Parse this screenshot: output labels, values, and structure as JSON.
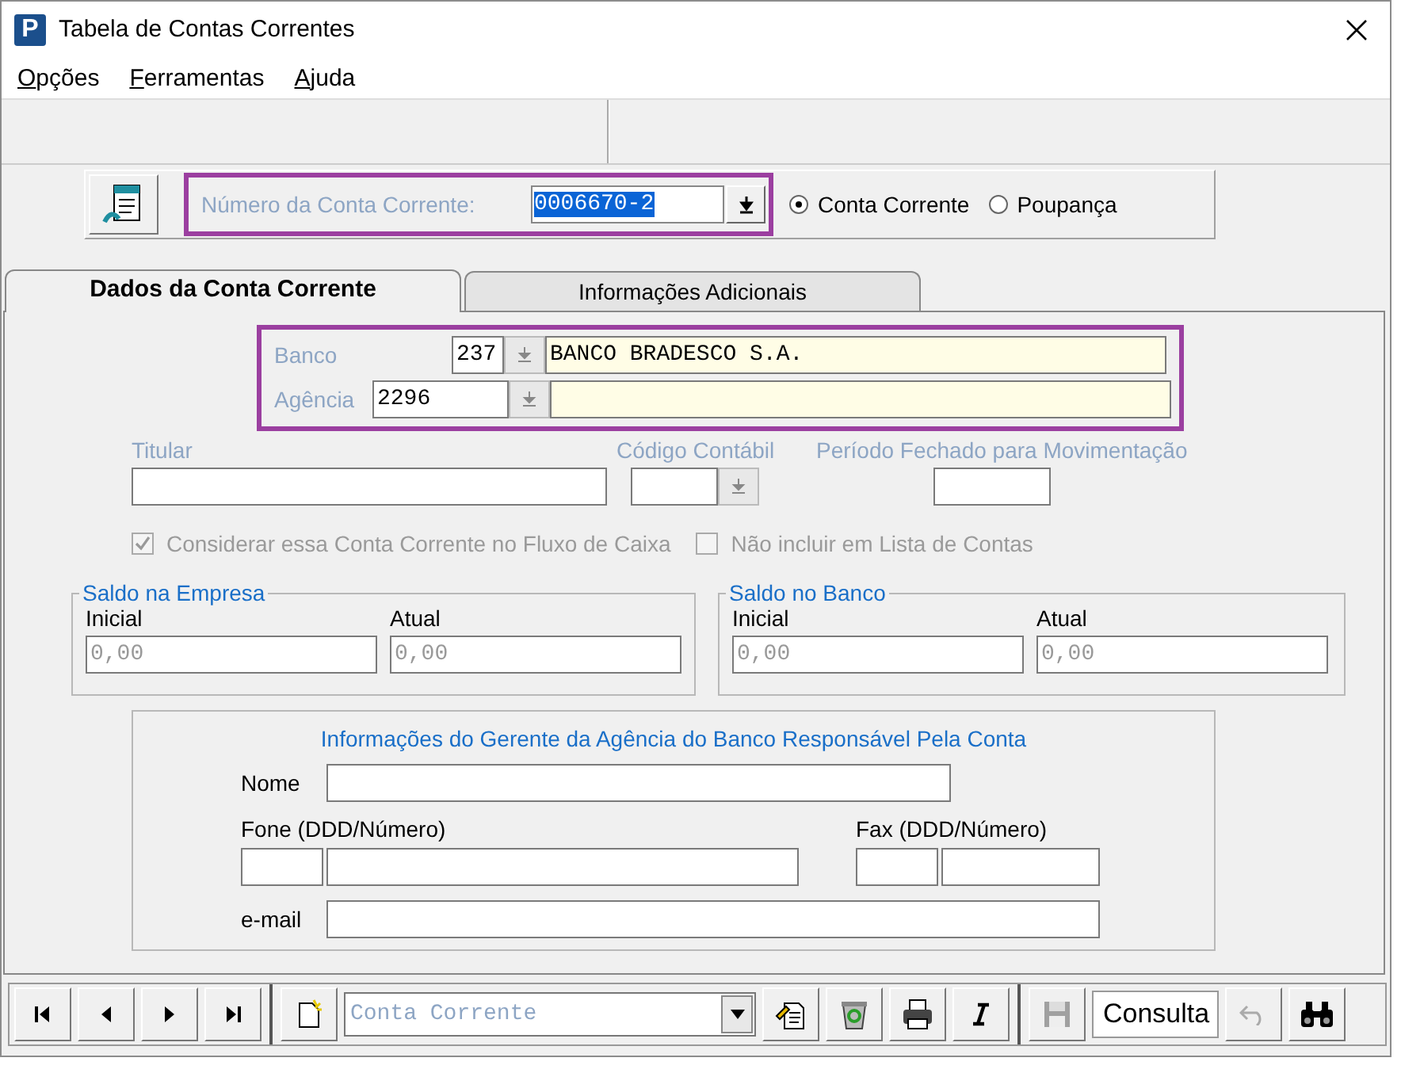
{
  "window": {
    "icon_letter": "P",
    "title": "Tabela de Contas Correntes"
  },
  "menu": [
    "Opções",
    "Ferramentas",
    "Ajuda"
  ],
  "account_selector": {
    "label": "Número da Conta Corrente:",
    "value": "0006670-2"
  },
  "account_type": [
    {
      "label": "Conta Corrente",
      "selected": true
    },
    {
      "label": "Poupança",
      "selected": false
    }
  ],
  "tabs": [
    {
      "label": "Dados da Conta Corrente",
      "selected": true
    },
    {
      "label": "Informações Adicionais",
      "selected": false
    }
  ],
  "bank": {
    "label": "Banco",
    "code": "237",
    "name": "BANCO BRADESCO S.A."
  },
  "agency": {
    "label": "Agência",
    "code": "2296"
  },
  "titular": {
    "label": "Titular"
  },
  "accounting_code": {
    "label": "Código Contábil"
  },
  "closed_period": {
    "label": "Período Fechado para Movimentação"
  },
  "checkboxes": [
    {
      "label": "Considerar essa Conta Corrente no Fluxo de Caixa",
      "checked": true,
      "disabled": true
    },
    {
      "label": "Não incluir em Lista de Contas",
      "checked": false,
      "disabled": true
    }
  ],
  "balances": [
    {
      "title": "Saldo na Empresa",
      "fields": [
        {
          "label": "Inicial",
          "value": "0,00"
        },
        {
          "label": "Atual",
          "value": "0,00"
        }
      ]
    },
    {
      "title": "Saldo no Banco",
      "fields": [
        {
          "label": "Inicial",
          "value": "0,00"
        },
        {
          "label": "Atual",
          "value": "0,00"
        }
      ]
    }
  ],
  "manager": {
    "title": "Informações do Gerente da Agência do Banco Responsável Pela Conta",
    "name_label": "Nome",
    "phone_label": "Fone (DDD/Número)",
    "fax_label": "Fax (DDD/Número)",
    "email_label": "e-mail"
  },
  "bottom_bar": {
    "navigation": [
      {
        "kind": "first"
      },
      {
        "kind": "previous"
      },
      {
        "kind": "next"
      },
      {
        "kind": "last"
      }
    ],
    "filter": "Conta Corrente",
    "tools": [
      {
        "kind": "edit"
      },
      {
        "kind": "delete"
      },
      {
        "kind": "print"
      },
      {
        "kind": "italic"
      }
    ],
    "save": {
      "disabled": true
    },
    "mode": "Consulta",
    "undo": {
      "disabled": true
    }
  }
}
